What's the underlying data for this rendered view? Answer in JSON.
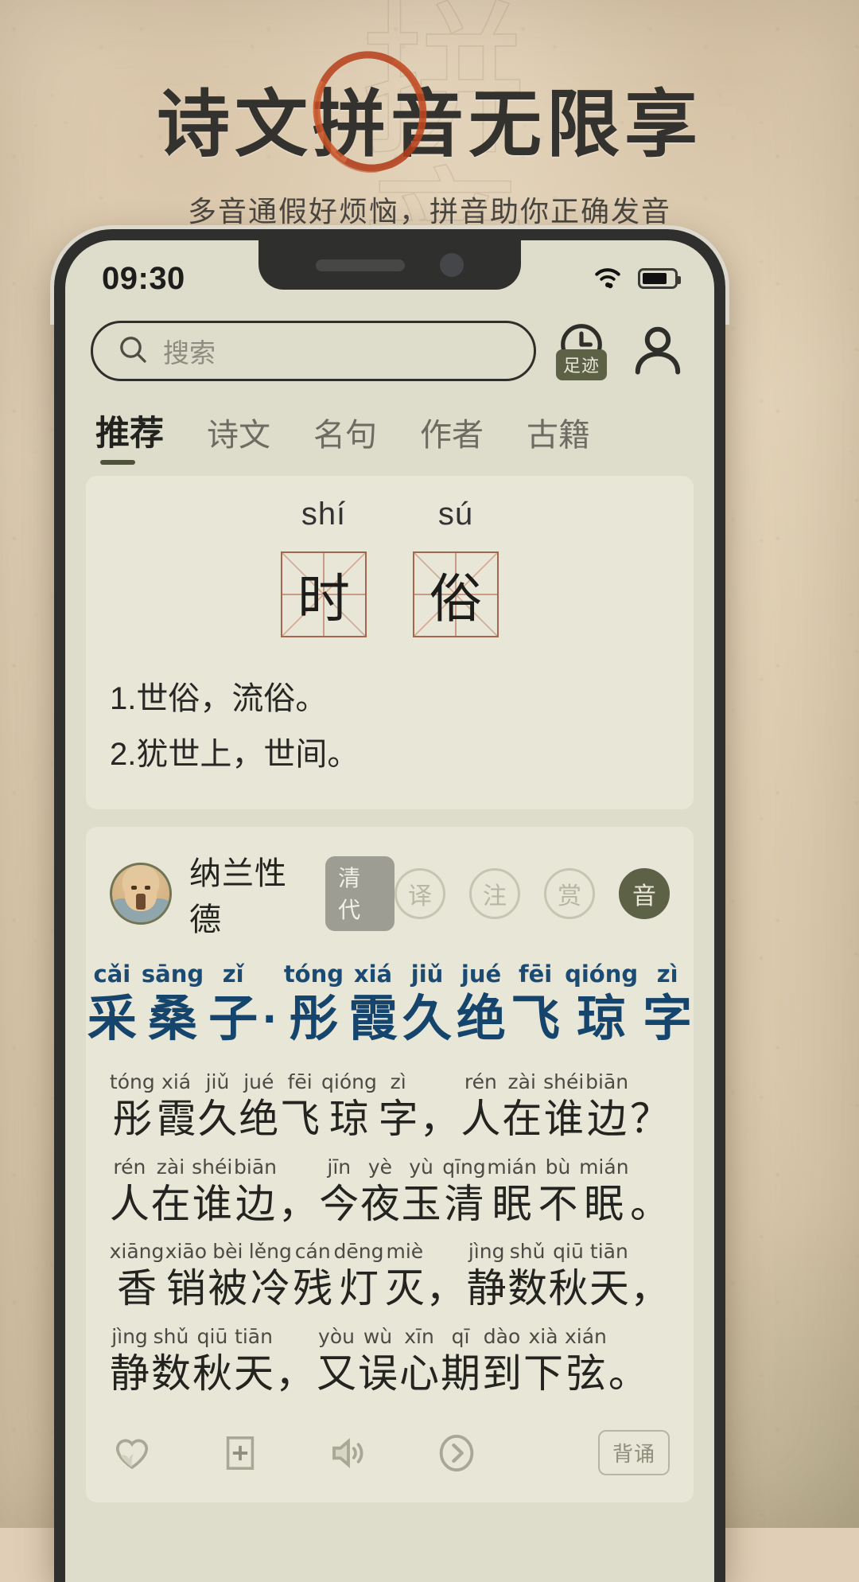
{
  "promo": {
    "headline": "诗文拼音无限享",
    "headline_chars": [
      "诗",
      "文",
      "拼",
      "音",
      "无",
      "限",
      "享"
    ],
    "circled_char": "音",
    "subtitle": "多音通假好烦恼，拼音助你正确发音",
    "accent_color": "#c24a22",
    "ghost_text": "拼音"
  },
  "status": {
    "time": "09:30",
    "wifi_icon": "wifi-icon",
    "battery_icon": "battery-icon"
  },
  "search": {
    "placeholder": "搜索",
    "icon": "search-icon"
  },
  "header_actions": {
    "history": {
      "label": "足迹",
      "icon": "clock-icon"
    },
    "profile": {
      "icon": "user-icon"
    }
  },
  "tabs": [
    {
      "label": "推荐",
      "active": true
    },
    {
      "label": "诗文",
      "active": false
    },
    {
      "label": "名句",
      "active": false
    },
    {
      "label": "作者",
      "active": false
    },
    {
      "label": "古籍",
      "active": false
    }
  ],
  "word_card": {
    "entries": [
      {
        "pinyin": "shí",
        "char": "时"
      },
      {
        "pinyin": "sú",
        "char": "俗"
      }
    ],
    "definitions": [
      "1.世俗，流俗。",
      "2.犹世上，世间。"
    ]
  },
  "poem_card": {
    "author": "纳兰性德",
    "dynasty": "清代",
    "seals": [
      {
        "label": "译",
        "filled": false
      },
      {
        "label": "注",
        "filled": false
      },
      {
        "label": "赏",
        "filled": false
      },
      {
        "label": "音",
        "filled": true
      }
    ],
    "title": {
      "color": "#15456d",
      "tokens": [
        {
          "py": "cǎi",
          "hz": "采"
        },
        {
          "py": "sāng",
          "hz": "桑"
        },
        {
          "py": "zǐ",
          "hz": "子"
        },
        {
          "py": "",
          "hz": "·"
        },
        {
          "py": "tóng",
          "hz": "彤"
        },
        {
          "py": "xiá",
          "hz": "霞"
        },
        {
          "py": "jiǔ",
          "hz": "久"
        },
        {
          "py": "jué",
          "hz": "绝"
        },
        {
          "py": "fēi",
          "hz": "飞"
        },
        {
          "py": "qióng",
          "hz": "琼"
        },
        {
          "py": "zì",
          "hz": "字"
        }
      ]
    },
    "lines": [
      [
        {
          "py": "tóng",
          "hz": "彤"
        },
        {
          "py": "xiá",
          "hz": "霞"
        },
        {
          "py": "jiǔ",
          "hz": "久"
        },
        {
          "py": "jué",
          "hz": "绝"
        },
        {
          "py": "fēi",
          "hz": "飞"
        },
        {
          "py": "qióng",
          "hz": "琼"
        },
        {
          "py": "zì",
          "hz": "字"
        },
        {
          "py": "",
          "hz": "，"
        },
        {
          "py": "rén",
          "hz": "人"
        },
        {
          "py": "zài",
          "hz": "在"
        },
        {
          "py": "shéi",
          "hz": "谁"
        },
        {
          "py": "biān",
          "hz": "边"
        },
        {
          "py": "",
          "hz": "？"
        }
      ],
      [
        {
          "py": "rén",
          "hz": "人"
        },
        {
          "py": "zài",
          "hz": "在"
        },
        {
          "py": "shéi",
          "hz": "谁"
        },
        {
          "py": "biān",
          "hz": "边"
        },
        {
          "py": "",
          "hz": "，"
        },
        {
          "py": "jīn",
          "hz": "今"
        },
        {
          "py": "yè",
          "hz": "夜"
        },
        {
          "py": "yù",
          "hz": "玉"
        },
        {
          "py": "qīng",
          "hz": "清"
        },
        {
          "py": "mián",
          "hz": "眠"
        },
        {
          "py": "bù",
          "hz": "不"
        },
        {
          "py": "mián",
          "hz": "眠"
        },
        {
          "py": "",
          "hz": "。"
        }
      ],
      [
        {
          "py": "xiāng",
          "hz": "香"
        },
        {
          "py": "xiāo",
          "hz": "销"
        },
        {
          "py": "bèi",
          "hz": "被"
        },
        {
          "py": "lěng",
          "hz": "冷"
        },
        {
          "py": "cán",
          "hz": "残"
        },
        {
          "py": "dēng",
          "hz": "灯"
        },
        {
          "py": "miè",
          "hz": "灭"
        },
        {
          "py": "",
          "hz": "，"
        },
        {
          "py": "jìng",
          "hz": "静"
        },
        {
          "py": "shǔ",
          "hz": "数"
        },
        {
          "py": "qiū",
          "hz": "秋"
        },
        {
          "py": "tiān",
          "hz": "天"
        },
        {
          "py": "",
          "hz": "，"
        }
      ],
      [
        {
          "py": "jìng",
          "hz": "静"
        },
        {
          "py": "shǔ",
          "hz": "数"
        },
        {
          "py": "qiū",
          "hz": "秋"
        },
        {
          "py": "tiān",
          "hz": "天"
        },
        {
          "py": "",
          "hz": "，"
        },
        {
          "py": "yòu",
          "hz": "又"
        },
        {
          "py": "wù",
          "hz": "误"
        },
        {
          "py": "xīn",
          "hz": "心"
        },
        {
          "py": "qī",
          "hz": "期"
        },
        {
          "py": "dào",
          "hz": "到"
        },
        {
          "py": "xià",
          "hz": "下"
        },
        {
          "py": "xián",
          "hz": "弦"
        },
        {
          "py": "",
          "hz": "。"
        }
      ]
    ],
    "actions": [
      {
        "icon": "heart-icon"
      },
      {
        "icon": "plus-square-icon"
      },
      {
        "icon": "speaker-icon"
      },
      {
        "icon": "arrow-right-circle-icon"
      }
    ],
    "recite_label": "背诵"
  }
}
